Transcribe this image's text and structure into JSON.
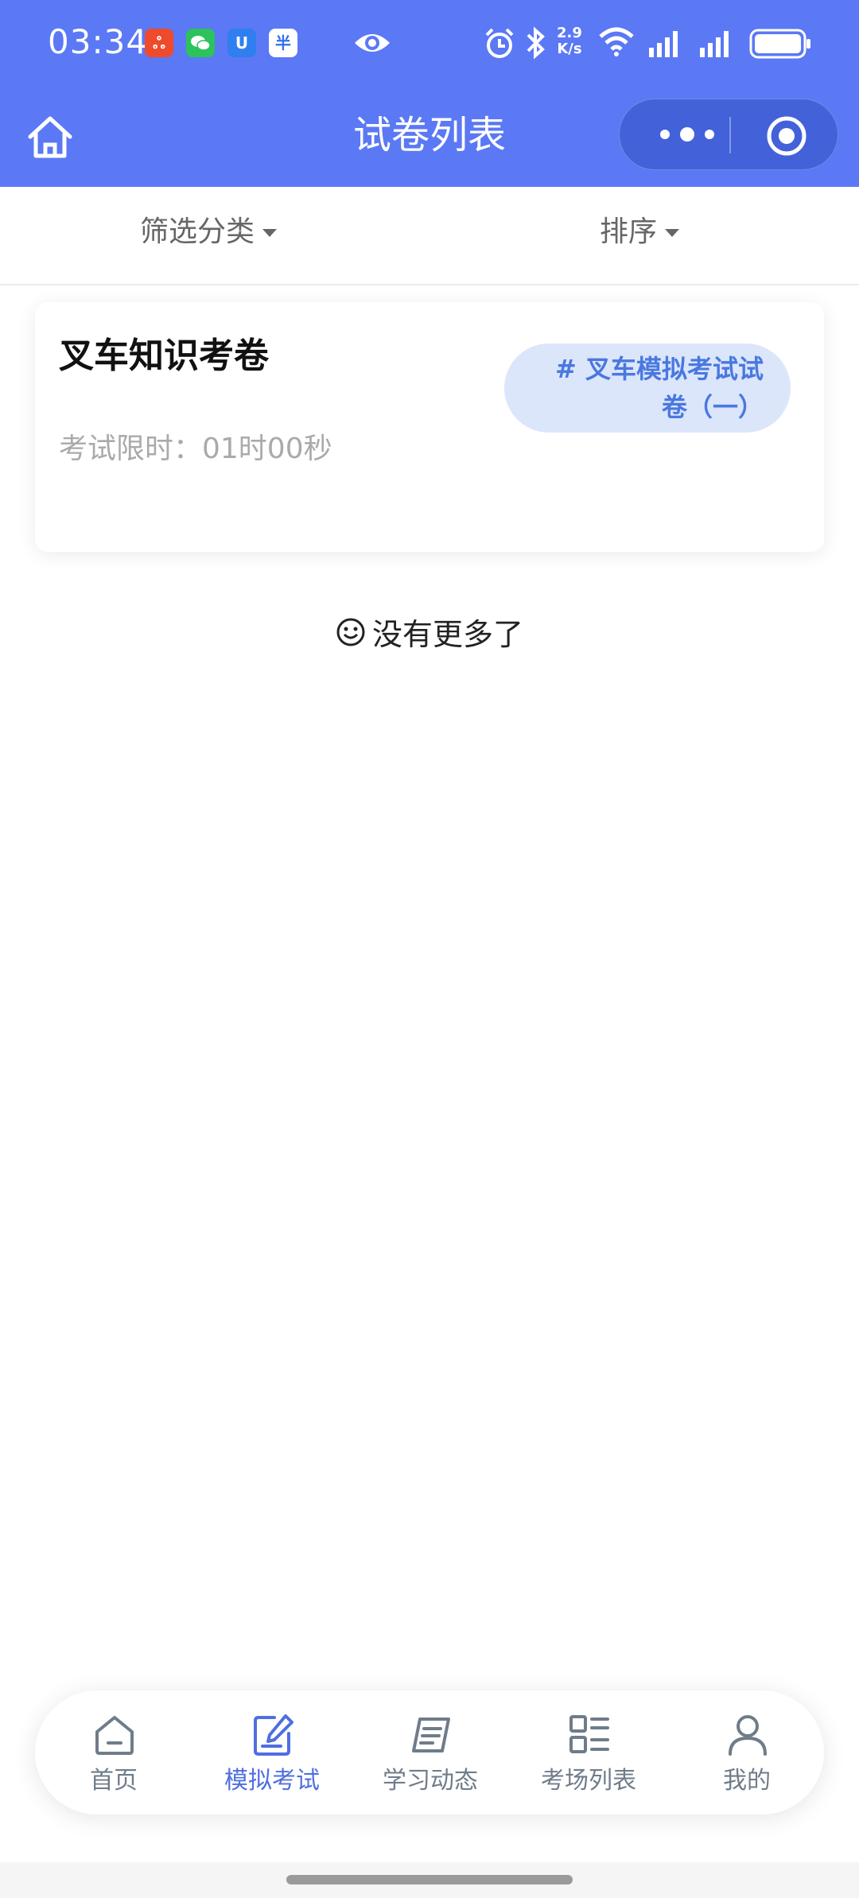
{
  "status_bar": {
    "time": "03:34",
    "net_speed_value": "2.9",
    "net_speed_unit": "K/s",
    "app_icons": [
      "xiaohongshu-icon",
      "wechat-icon",
      "u-app-icon",
      "shopping-app-icon"
    ],
    "indicators": [
      "eye-icon",
      "alarm-icon",
      "bluetooth-icon",
      "wifi-icon",
      "signal-icon",
      "signal-icon",
      "battery-icon"
    ]
  },
  "nav": {
    "title": "试卷列表",
    "home_icon": "home-icon",
    "more_icon": "more-dots-icon",
    "close_icon": "target-icon"
  },
  "filter": {
    "category_label": "筛选分类",
    "sort_label": "排序"
  },
  "exams": [
    {
      "title": "叉车知识考卷",
      "time_limit": "考试限时：01时00秒",
      "tag_line1": "# 叉车模拟考试试",
      "tag_line2": "卷（一）"
    }
  ],
  "list_end_text": "没有更多了",
  "tabbar": {
    "active_tab": "模拟考试",
    "tabs": [
      {
        "label": "首页",
        "icon": "home-icon"
      },
      {
        "label": "模拟考试",
        "icon": "edit-note-icon"
      },
      {
        "label": "学习动态",
        "icon": "document-list-icon"
      },
      {
        "label": "考场列表",
        "icon": "grid-list-icon"
      },
      {
        "label": "我的",
        "icon": "user-icon"
      }
    ]
  },
  "colors": {
    "primary": "#5b78f5",
    "tag_bg": "#dbe6fb",
    "tag_text": "#4a78e0",
    "tab_active": "#4f6fe0",
    "tab_inactive": "#6f7c8a"
  }
}
